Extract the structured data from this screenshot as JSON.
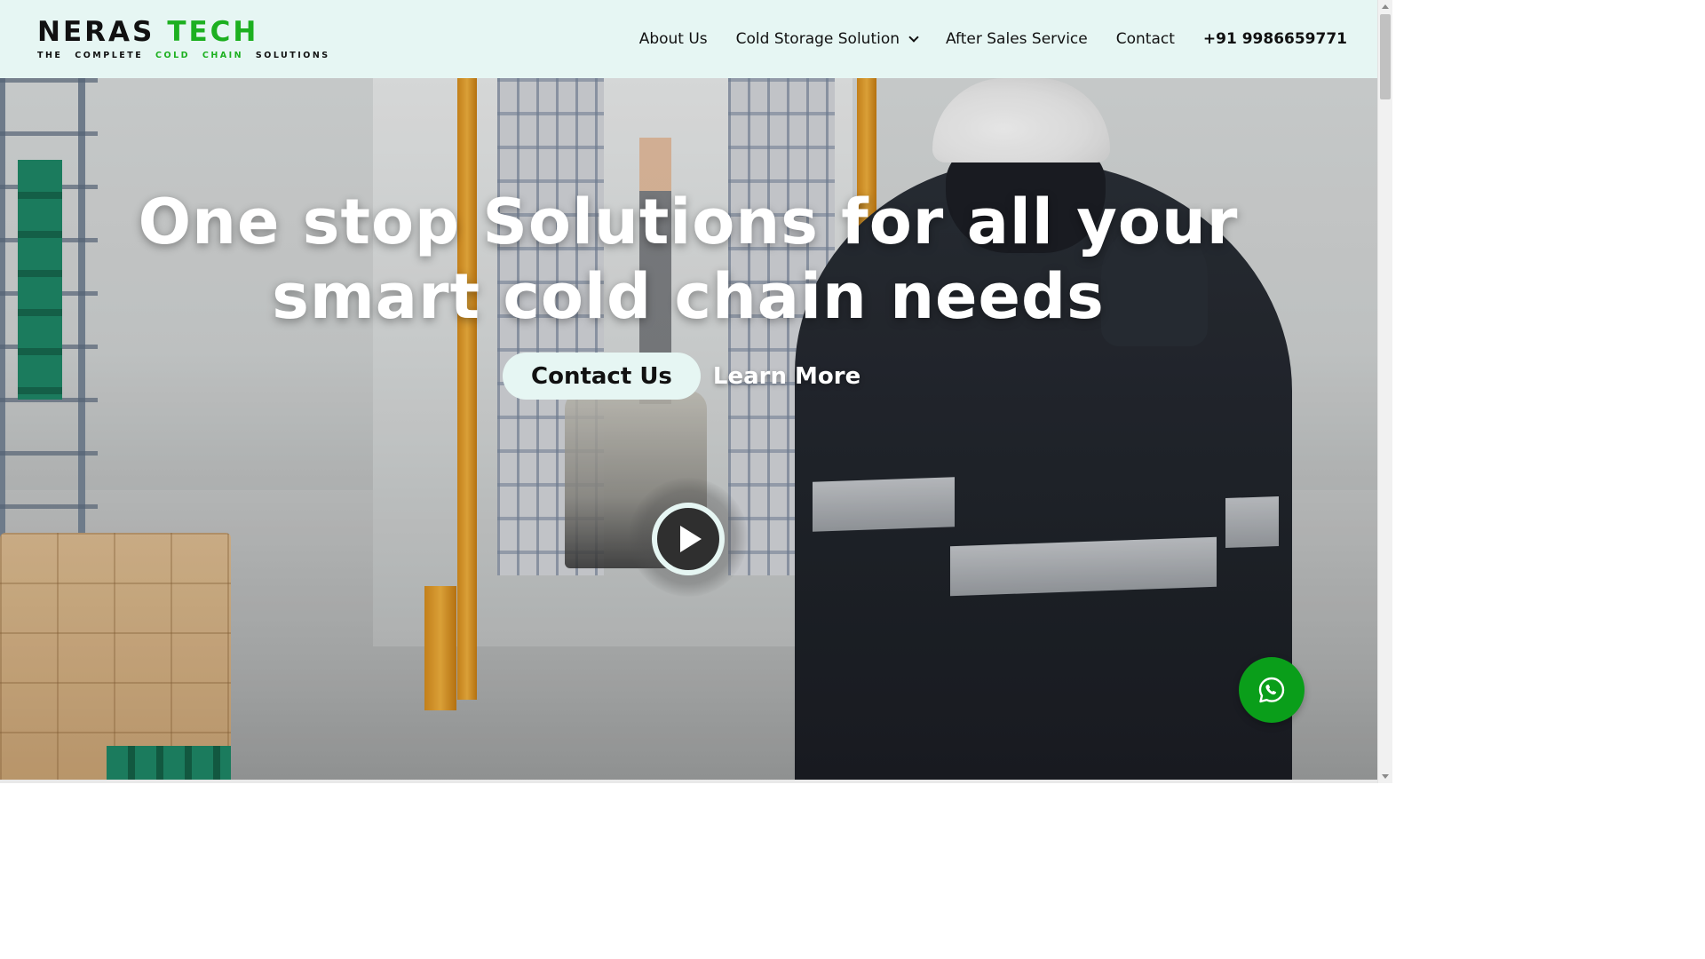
{
  "brand": {
    "name_part1": "NERAS",
    "name_part2": "TECH",
    "tagline": [
      "THE",
      "COMPLETE",
      "COLD",
      "CHAIN",
      "SOLUTIONS"
    ],
    "colors": {
      "dark": "#111111",
      "green": "#1db020"
    }
  },
  "nav": {
    "items": [
      {
        "label": "About Us"
      },
      {
        "label": "Cold Storage Solution",
        "has_dropdown": true
      },
      {
        "label": "After Sales Service"
      },
      {
        "label": "Contact"
      }
    ],
    "phone": "+91 9986659771"
  },
  "hero": {
    "headline_line1": "One stop Solutions for all your",
    "headline_line2": "smart cold chain needs",
    "primary_cta": "Contact Us",
    "secondary_cta": "Learn More",
    "play_icon": "play-icon"
  },
  "floating": {
    "whatsapp_icon": "whatsapp-icon",
    "whatsapp_color": "#0a9e1a"
  },
  "theme": {
    "header_bg": "#e6f6f3",
    "text_dark": "#111111"
  }
}
